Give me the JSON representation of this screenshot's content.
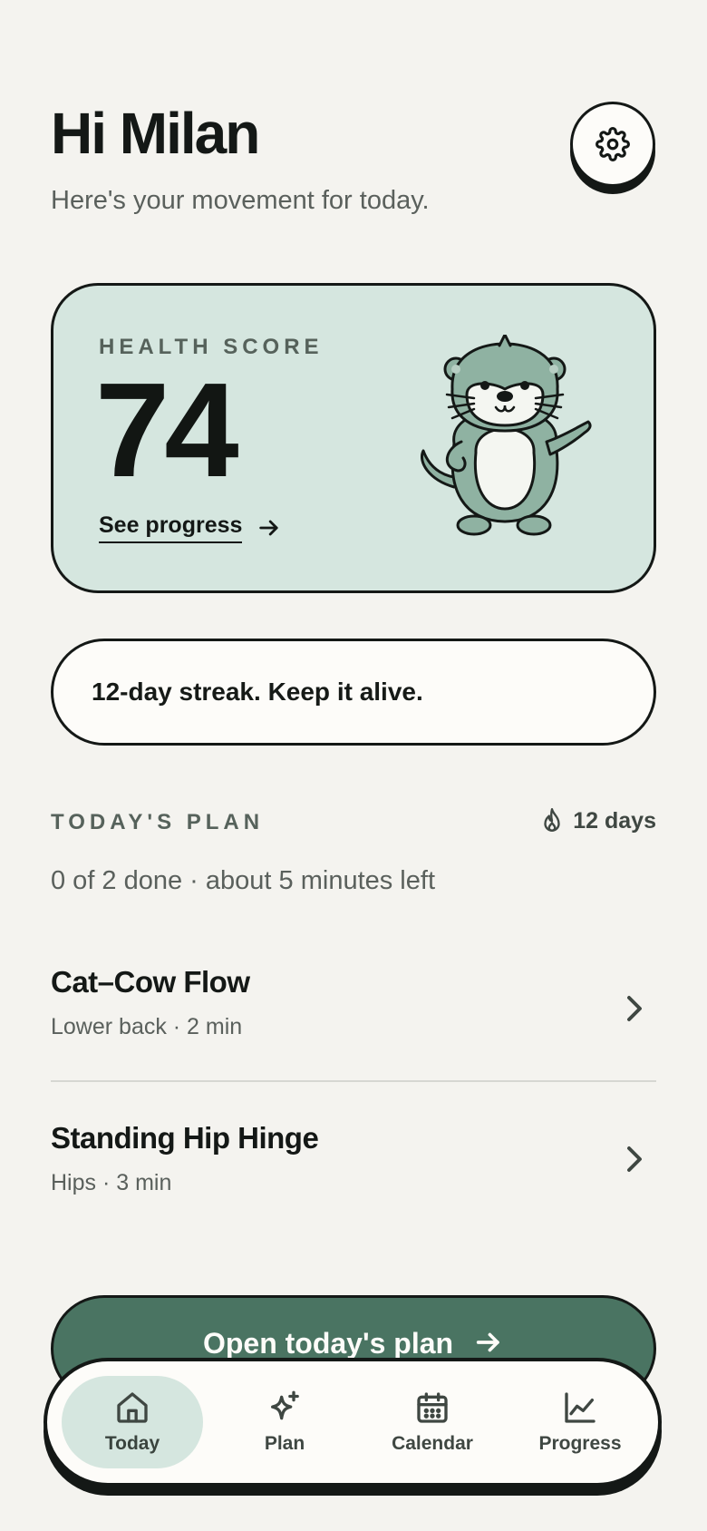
{
  "header": {
    "greeting": "Hi Milan",
    "subtitle": "Here's your movement for today.",
    "settings_icon": "gear-icon"
  },
  "health": {
    "label": "HEALTH SCORE",
    "value": "74",
    "link_label": "See progress",
    "link_icon": "arrow-right-icon",
    "mascot": "otter-mascot-pointing"
  },
  "streak": {
    "message": "12-day streak. Keep it alive."
  },
  "plan": {
    "heading": "TODAY'S PLAN",
    "streak_days": "12 days",
    "streak_icon": "flame-icon",
    "summary": "0 of 2 done · about 5 minutes left",
    "items": [
      {
        "title": "Cat–Cow Flow",
        "meta": "Lower back · 2 min"
      },
      {
        "title": "Standing Hip Hinge",
        "meta": "Hips · 3 min"
      }
    ]
  },
  "cta": {
    "label": "Open today's plan",
    "icon": "arrow-right-icon"
  },
  "nav": {
    "items": [
      {
        "label": "Today",
        "icon": "home-icon",
        "active": true
      },
      {
        "label": "Plan",
        "icon": "sparkle-icon",
        "active": false
      },
      {
        "label": "Calendar",
        "icon": "calendar-icon",
        "active": false
      },
      {
        "label": "Progress",
        "icon": "chart-icon",
        "active": false
      }
    ]
  },
  "colors": {
    "background": "#f4f3ef",
    "ink": "#141816",
    "mint": "#d5e6df",
    "primary": "#4a7462",
    "muted": "#5a605c",
    "card": "#fdfcf9"
  }
}
